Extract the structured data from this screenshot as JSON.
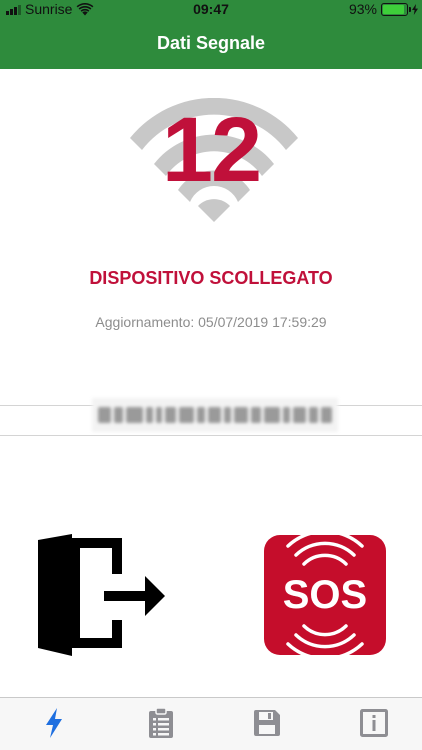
{
  "status_bar": {
    "carrier": "Sunrise",
    "time": "09:47",
    "battery_percent": "93%",
    "battery_level": 0.93
  },
  "header": {
    "title": "Dati Segnale"
  },
  "signal": {
    "value": "12",
    "status": "DISPOSITIVO SCOLLEGATO",
    "update_label": "Aggiornamento: 05/07/2019 17:59:29"
  },
  "actions": {
    "exit_icon": "exit-door-arrow-icon",
    "sos_label": "SOS"
  },
  "tab_bar": {
    "tabs": [
      {
        "name": "signal",
        "icon": "lightning-icon",
        "active": true
      },
      {
        "name": "list",
        "icon": "clipboard-list-icon",
        "active": false
      },
      {
        "name": "save",
        "icon": "floppy-disk-icon",
        "active": false
      },
      {
        "name": "info",
        "icon": "info-icon",
        "active": false
      }
    ],
    "active_color": "#1e6fe0",
    "inactive_color": "#8e8e93"
  },
  "colors": {
    "brand_green": "#2e8b3c",
    "alert_red": "#c0103a",
    "sos_red": "#c50d2b"
  }
}
